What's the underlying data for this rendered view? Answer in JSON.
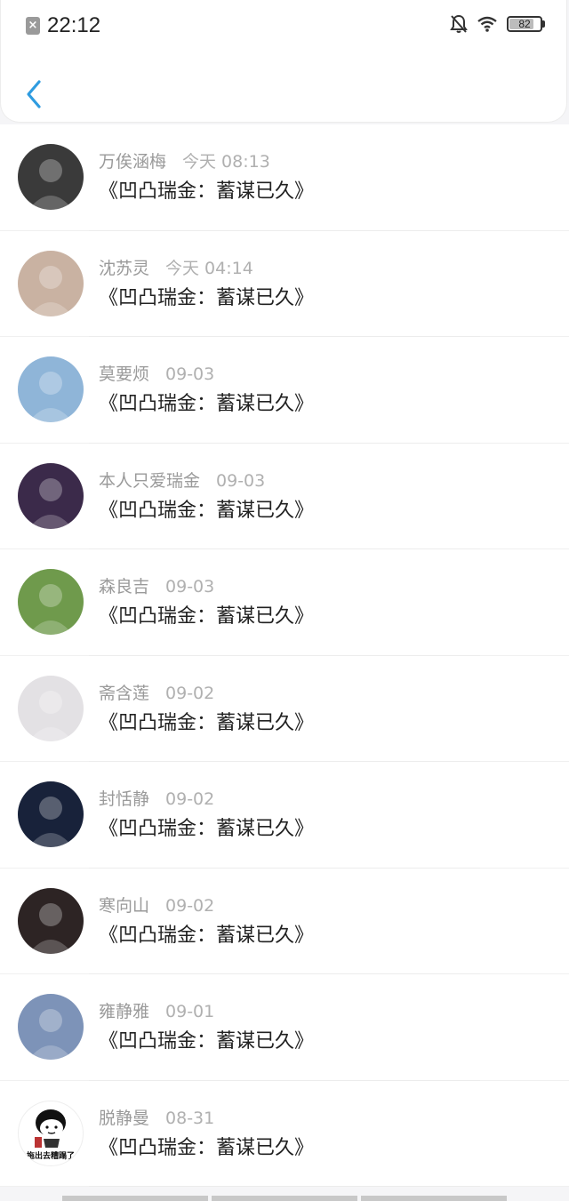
{
  "status_bar": {
    "time": "22:12",
    "battery": 82
  },
  "header": {
    "back_icon": "chevron-left-icon"
  },
  "messages": [
    {
      "name": "万俟涵梅",
      "time": "今天 08:13",
      "text": "《凹凸瑞金：蓄谋已久》",
      "avatar_color": "#3a3a3a"
    },
    {
      "name": "沈苏灵",
      "time": "今天 04:14",
      "text": "《凹凸瑞金：蓄谋已久》",
      "avatar_color": "#c9b2a2"
    },
    {
      "name": "莫要烦",
      "time": "09-03",
      "text": "《凹凸瑞金：蓄谋已久》",
      "avatar_color": "#8fb5d8"
    },
    {
      "name": "本人只爱瑞金",
      "time": "09-03",
      "text": "《凹凸瑞金：蓄谋已久》",
      "avatar_color": "#3b2a4a"
    },
    {
      "name": "森良吉",
      "time": "09-03",
      "text": "《凹凸瑞金：蓄谋已久》",
      "avatar_color": "#6f9a4c"
    },
    {
      "name": "斋含莲",
      "time": "09-02",
      "text": "《凹凸瑞金：蓄谋已久》",
      "avatar_color": "#e3e1e4"
    },
    {
      "name": "封恬静",
      "time": "09-02",
      "text": "《凹凸瑞金：蓄谋已久》",
      "avatar_color": "#18223a"
    },
    {
      "name": "寒向山",
      "time": "09-02",
      "text": "《凹凸瑞金：蓄谋已久》",
      "avatar_color": "#2d2424"
    },
    {
      "name": "雍静雅",
      "time": "09-01",
      "text": "《凹凸瑞金：蓄谋已久》",
      "avatar_color": "#7d93b8"
    },
    {
      "name": "脱静曼",
      "time": "08-31",
      "text": "《凹凸瑞金：蓄谋已久》",
      "avatar_color": "#ffffff",
      "avatar_caption": "拖出去糟蹋了"
    }
  ]
}
